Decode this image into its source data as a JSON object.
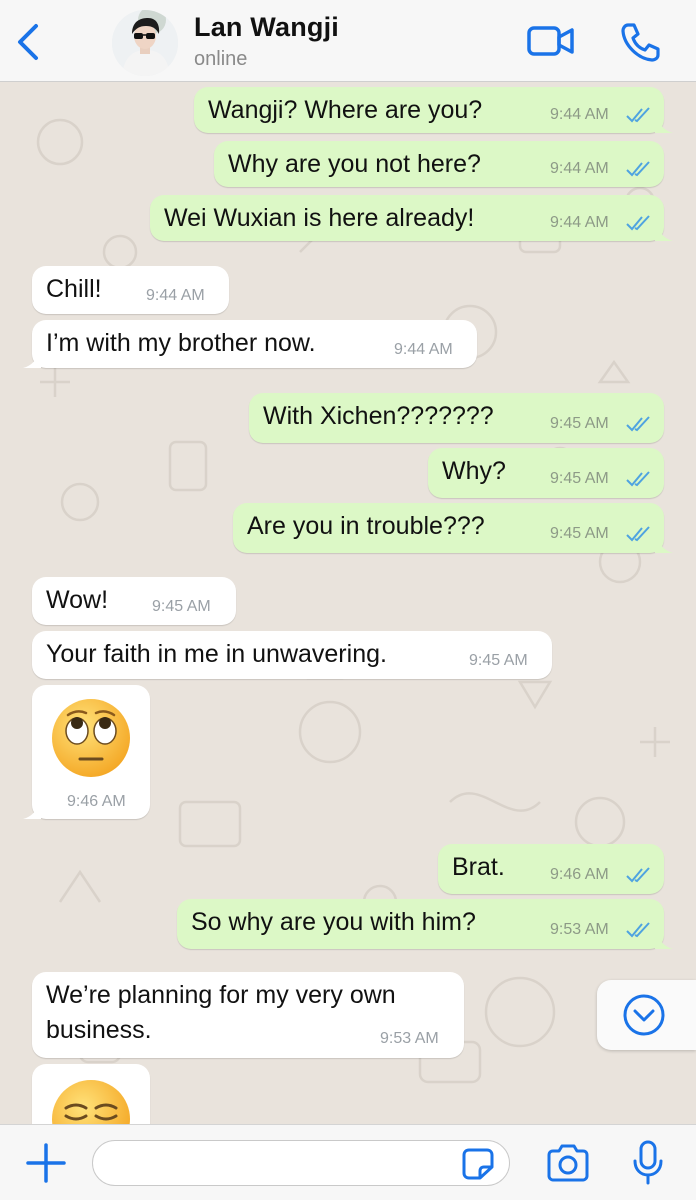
{
  "header": {
    "back_icon": "chevron-left-icon",
    "contact_name": "Lan Wangji",
    "status": "online",
    "video_icon": "video-camera-icon",
    "call_icon": "phone-icon",
    "accent_color": "#1a73e8"
  },
  "messages": [
    {
      "direction": "out",
      "text": "Wangji? Where are you?",
      "time": "9:44 AM",
      "read": true
    },
    {
      "direction": "out",
      "text": "Why are you not here?",
      "time": "9:44 AM",
      "read": true
    },
    {
      "direction": "out",
      "text": "Wei Wuxian is here already!",
      "time": "9:44 AM",
      "read": true
    },
    {
      "direction": "in",
      "text": "Chill!",
      "time": "9:44 AM"
    },
    {
      "direction": "in",
      "text": "I’m with my brother now.",
      "time": "9:44 AM"
    },
    {
      "direction": "out",
      "text": "With Xichen???????",
      "time": "9:45 AM",
      "read": true
    },
    {
      "direction": "out",
      "text": "Why?",
      "time": "9:45 AM",
      "read": true
    },
    {
      "direction": "out",
      "text": "Are you in trouble???",
      "time": "9:45 AM",
      "read": true
    },
    {
      "direction": "in",
      "text": "Wow!",
      "time": "9:45 AM"
    },
    {
      "direction": "in",
      "text": "Your faith in me in unwavering.",
      "time": "9:45 AM"
    },
    {
      "direction": "in",
      "emoji": "face-with-rolling-eyes",
      "time": "9:46 AM"
    },
    {
      "direction": "out",
      "text": "Brat.",
      "time": "9:46 AM",
      "read": true
    },
    {
      "direction": "out",
      "text": "So why are you with him?",
      "time": "9:53 AM",
      "read": true
    },
    {
      "direction": "in",
      "text_lines": [
        "We’re planning for my very own",
        "business."
      ],
      "time": "9:53 AM"
    },
    {
      "direction": "in",
      "emoji": "smirking-face"
    }
  ],
  "colors": {
    "outgoing_bubble": "#dcf8c6",
    "incoming_bubble": "#ffffff",
    "chat_background": "#e9e3dc",
    "read_ticks": "#4fa3e0"
  },
  "scroll_down_icon": "chevron-down-circle-icon",
  "composer": {
    "plus_icon": "plus-icon",
    "input_value": "",
    "sticker_icon": "sticker-icon",
    "camera_icon": "camera-icon",
    "mic_icon": "microphone-icon"
  }
}
